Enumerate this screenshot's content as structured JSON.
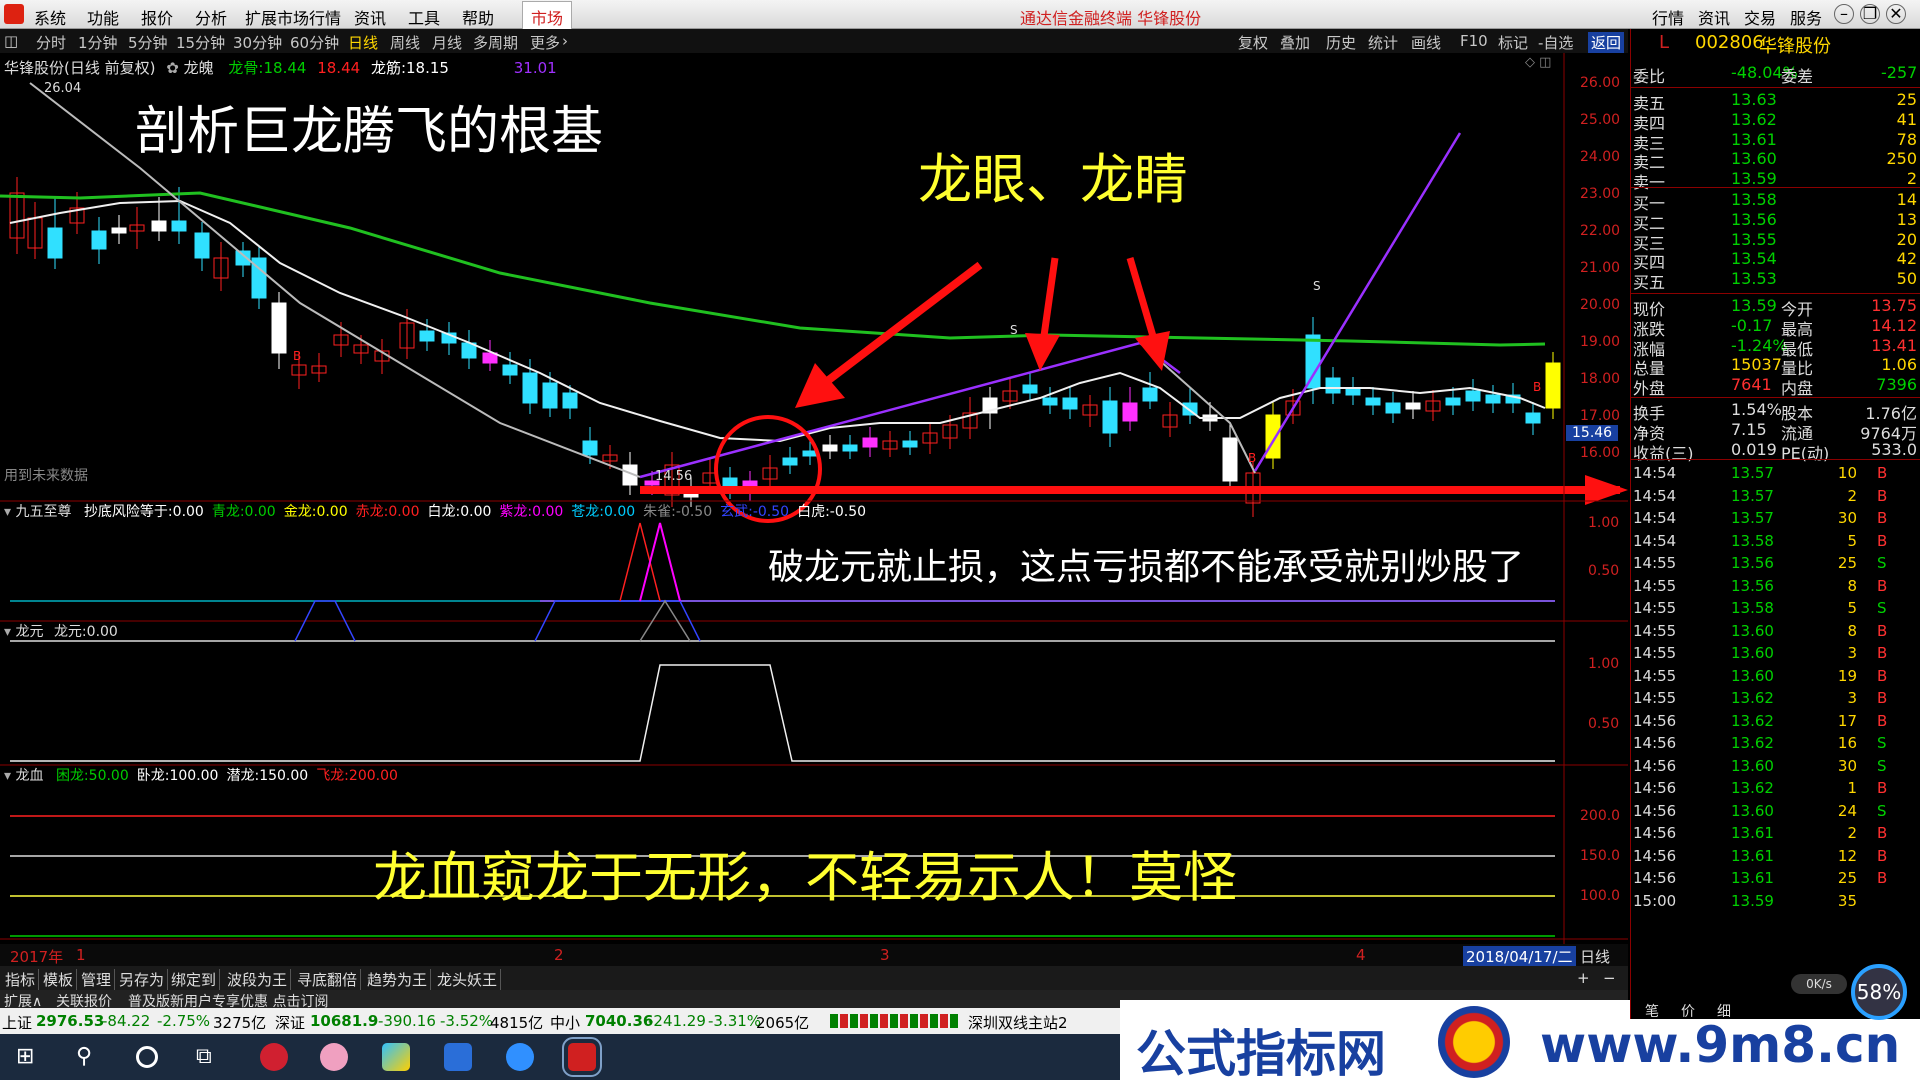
{
  "menu": {
    "items": [
      "系统",
      "功能",
      "报价",
      "分析",
      "扩展市场行情",
      "资讯",
      "工具",
      "帮助"
    ],
    "market": "市场",
    "center_title": "通达信金融终端 华锋股份",
    "right_buttons": [
      "行情",
      "资讯",
      "交易",
      "服务"
    ]
  },
  "toolbar": {
    "periods": [
      "分时",
      "1分钟",
      "5分钟",
      "15分钟",
      "30分钟",
      "60分钟",
      "日线",
      "周线",
      "月线",
      "多周期",
      "更多"
    ],
    "tools": [
      "复权",
      "叠加",
      "历史",
      "统计",
      "画线",
      "F10",
      "标记",
      "-自选",
      "返回"
    ]
  },
  "chart": {
    "title": "华锋股份(日线 前复权)",
    "indicator_name": "龙魄",
    "legend": [
      {
        "label": "龙骨:",
        "value": "18.44"
      },
      {
        "label": "",
        "value": "18.44"
      },
      {
        "label": "龙筋:",
        "value": "18.15"
      },
      {
        "label": "",
        "value": "31.01"
      }
    ],
    "high_label": "26.04",
    "low_label": "14.56",
    "future_note": "用到未来数据",
    "price_tag": "15.46",
    "price_axis": [
      "26.00",
      "25.00",
      "24.00",
      "23.00",
      "22.00",
      "21.00",
      "20.00",
      "19.00",
      "18.00",
      "17.00",
      "16.00"
    ],
    "headline": "剖析巨龙腾飞的根基",
    "eye_title": "龙眼、龙睛",
    "stop_note": "破龙元就止损，这点亏损都不能承受就别炒股了",
    "blood_note": "龙血窥龙于无形，不轻易示人！莫怪",
    "sig_s": "S",
    "sig_b": "B"
  },
  "panel2": {
    "title": "九五至尊",
    "fields": [
      {
        "label": "抄底风险等于:",
        "value": "0.00",
        "color": "#ffffff"
      },
      {
        "label": "青龙:",
        "value": "0.00",
        "color": "#00cc00"
      },
      {
        "label": "金龙:",
        "value": "0.00",
        "color": "#ffff00"
      },
      {
        "label": "赤龙:",
        "value": "0.00",
        "color": "#ff2020"
      },
      {
        "label": "白龙:",
        "value": "0.00",
        "color": "#ffffff"
      },
      {
        "label": "紫龙:",
        "value": "0.00",
        "color": "#ff00ff"
      },
      {
        "label": "苍龙:",
        "value": "0.00",
        "color": "#00ccff"
      },
      {
        "label": "朱雀:",
        "value": "-0.50",
        "color": "#888888"
      },
      {
        "label": "玄武:",
        "value": "-0.50",
        "color": "#3344ff"
      },
      {
        "label": "白虎:",
        "value": "-0.50",
        "color": "#ffffff"
      }
    ],
    "axis": [
      "1.00",
      "0.50"
    ]
  },
  "panel3": {
    "title": "龙元",
    "field": "龙元:",
    "value": "0.00",
    "axis": [
      "1.00",
      "0.50"
    ]
  },
  "panel4": {
    "title": "龙血",
    "fields": [
      {
        "label": "困龙:",
        "value": "50.00",
        "color": "#00cc00"
      },
      {
        "label": "卧龙:",
        "value": "100.00",
        "color": "#ffffff"
      },
      {
        "label": "潜龙:",
        "value": "150.00",
        "color": "#ffffff"
      },
      {
        "label": "飞龙:",
        "value": "200.00",
        "color": "#ff2020"
      }
    ],
    "axis": [
      "200.0",
      "150.0",
      "100.0"
    ]
  },
  "time_axis": {
    "year": "2017年",
    "marks": [
      "1",
      "2",
      "3",
      "4"
    ],
    "date": "2018/04/17/二",
    "period": "日线"
  },
  "subtabs": [
    "指标",
    "模板",
    "管理",
    "另存为",
    "绑定到",
    "波段为王",
    "寻底翻倍",
    "趋势为王",
    "龙头妖王"
  ],
  "tabs2": [
    "扩展∧",
    "关联报价",
    "普及版新用户专享优惠 点击订阅"
  ],
  "status": {
    "sh": {
      "name": "上证",
      "price": "2976.53",
      "chg": "-84.22",
      "pct": "-2.75%",
      "amt": "3275亿"
    },
    "sz": {
      "name": "深证",
      "price": "10681.9",
      "chg": "-390.16",
      "pct": "-3.52%",
      "amt": "4815亿"
    },
    "zx": {
      "name": "中小",
      "price": "7040.36",
      "chg": "-241.29",
      "pct": "-3.31%",
      "amt": "2065亿"
    },
    "server": "深圳双线主站2"
  },
  "quote": {
    "code": "002806",
    "name": "华锋股份",
    "flag": "L",
    "wb": {
      "label1": "委比",
      "v1": "-48.04%",
      "label2": "委差",
      "v2": "-257"
    },
    "asks": [
      {
        "l": "卖五",
        "p": "13.63",
        "v": "25"
      },
      {
        "l": "卖四",
        "p": "13.62",
        "v": "41"
      },
      {
        "l": "卖三",
        "p": "13.61",
        "v": "78"
      },
      {
        "l": "卖二",
        "p": "13.60",
        "v": "250"
      },
      {
        "l": "卖一",
        "p": "13.59",
        "v": "2"
      }
    ],
    "bids": [
      {
        "l": "买一",
        "p": "13.58",
        "v": "14"
      },
      {
        "l": "买二",
        "p": "13.56",
        "v": "13"
      },
      {
        "l": "买三",
        "p": "13.55",
        "v": "20"
      },
      {
        "l": "买四",
        "p": "13.54",
        "v": "42"
      },
      {
        "l": "买五",
        "p": "13.53",
        "v": "50"
      }
    ],
    "stats": [
      {
        "l1": "现价",
        "v1": "13.59",
        "l2": "今开",
        "v2": "13.75"
      },
      {
        "l1": "涨跌",
        "v1": "-0.17",
        "l2": "最高",
        "v2": "14.12"
      },
      {
        "l1": "涨幅",
        "v1": "-1.24%",
        "l2": "最低",
        "v2": "13.41"
      },
      {
        "l1": "总量",
        "v1": "15037",
        "l2": "量比",
        "v2": "1.06"
      },
      {
        "l1": "外盘",
        "v1": "7641",
        "l2": "内盘",
        "v2": "7396"
      }
    ],
    "stats2": [
      {
        "l1": "换手",
        "v1": "1.54%",
        "l2": "股本",
        "v2": "1.76亿"
      },
      {
        "l1": "净资",
        "v1": "7.15",
        "l2": "流通",
        "v2": "9764万"
      },
      {
        "l1": "收益(三)",
        "v1": "0.019",
        "l2": "PE(动)",
        "v2": "533.0"
      }
    ],
    "ticks": [
      [
        "14:54",
        "13.57",
        "10",
        "B"
      ],
      [
        "14:54",
        "13.57",
        "2",
        "B"
      ],
      [
        "14:54",
        "13.57",
        "30",
        "B"
      ],
      [
        "14:54",
        "13.58",
        "5",
        "B"
      ],
      [
        "14:55",
        "13.56",
        "25",
        "S"
      ],
      [
        "14:55",
        "13.56",
        "8",
        "B"
      ],
      [
        "14:55",
        "13.58",
        "5",
        "S"
      ],
      [
        "14:55",
        "13.60",
        "8",
        "B"
      ],
      [
        "14:55",
        "13.60",
        "3",
        "B"
      ],
      [
        "14:55",
        "13.60",
        "19",
        "B"
      ],
      [
        "14:55",
        "13.62",
        "3",
        "B"
      ],
      [
        "14:56",
        "13.62",
        "17",
        "B"
      ],
      [
        "14:56",
        "13.62",
        "16",
        "S"
      ],
      [
        "14:56",
        "13.60",
        "30",
        "S"
      ],
      [
        "14:56",
        "13.62",
        "1",
        "B"
      ],
      [
        "14:56",
        "13.60",
        "24",
        "S"
      ],
      [
        "14:56",
        "13.61",
        "2",
        "B"
      ],
      [
        "14:56",
        "13.61",
        "12",
        "B"
      ],
      [
        "14:56",
        "13.61",
        "25",
        "B"
      ],
      [
        "15:00",
        "13.59",
        "35",
        ""
      ]
    ],
    "bottom_tabs": [
      "笔",
      "价",
      "细"
    ],
    "speed": "0K/s",
    "pct_badge": "58%"
  },
  "banner": {
    "text": "公式指标网",
    "url": "www.9m8.cn"
  }
}
